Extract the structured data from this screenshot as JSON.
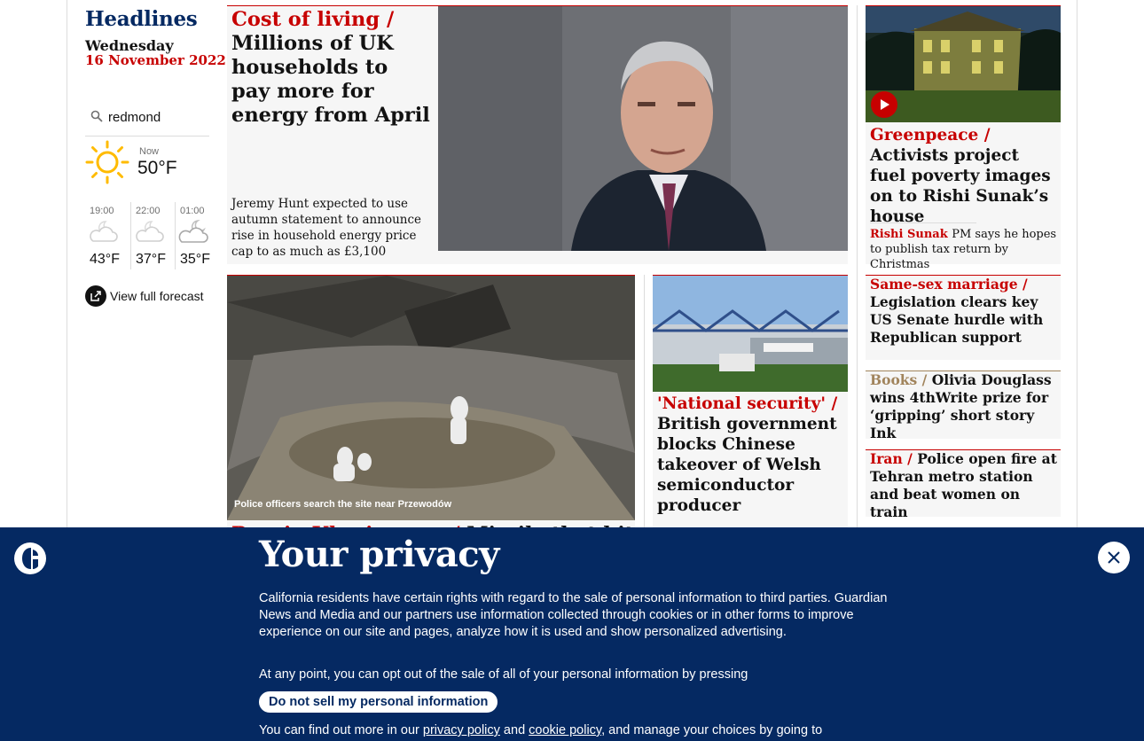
{
  "sidebar": {
    "title": "Headlines",
    "weekday": "Wednesday",
    "date": "16 November 2022",
    "weather": {
      "location": "redmond",
      "now_label": "Now",
      "now_temp": "50°F",
      "forecast": [
        {
          "time": "19:00",
          "temp": "43°F",
          "icon": "cloudy-night-icon"
        },
        {
          "time": "22:00",
          "temp": "37°F",
          "icon": "cloudy-night-icon"
        },
        {
          "time": "01:00",
          "temp": "35°F",
          "icon": "partly-cloudy-night-icon"
        }
      ],
      "full_forecast_label": "View full forecast"
    }
  },
  "stories": {
    "lead": {
      "kicker": "Cost of living /",
      "headline": "Millions of UK households to pay more for energy from April",
      "standfirst": "Jeremy Hunt expected to use autumn statement to announce rise in household energy price cap to as much as £3,100"
    },
    "greenpeace": {
      "kicker": "Greenpeace /",
      "headline": "Activists project fuel poverty images on to Rishi Sunak’s house",
      "sub_kicker": "Rishi Sunak",
      "sub_headline": "PM says he hopes to publish tax return by Christmas"
    },
    "ukraine": {
      "caption": "Police officers search the site near Przewodów",
      "kicker": "Russia-Ukraine war /",
      "headline": "Missile that hit"
    },
    "security": {
      "kicker": "'National security' /",
      "headline": "British government blocks Chinese takeover of Welsh semiconductor producer"
    },
    "marriage": {
      "kicker": "Same-sex marriage /",
      "headline": "Legislation clears key US Senate hurdle with Republican support"
    },
    "books": {
      "kicker": "Books /",
      "headline": "Olivia Douglass wins 4thWrite prize for ‘gripping’ short story Ink"
    },
    "iran": {
      "kicker": "Iran /",
      "headline": "Police open fire at Tehran metro station and beat women on train"
    }
  },
  "consent": {
    "title": "Your privacy",
    "paragraph1": "California residents have certain rights with regard to the sale of personal information to third parties. Guardian News and Media and our partners use information collected through cookies or in other forms to improve experience on our site and pages, analyze how it is used and show personalized advertising.",
    "paragraph2": "At any point, you can opt out of the sale of all of your personal information by pressing",
    "button": "Do not sell my personal information",
    "para3_before": "You can find out more in our ",
    "privacy_link": "privacy policy",
    "para3_and": " and ",
    "cookie_link": "cookie policy",
    "para3_after": ", and manage your choices by going to"
  },
  "colors": {
    "news_red": "#c70000",
    "brand_blue": "#052962",
    "culture_gold": "#a1845c",
    "card_bg": "#f6f6f6"
  }
}
